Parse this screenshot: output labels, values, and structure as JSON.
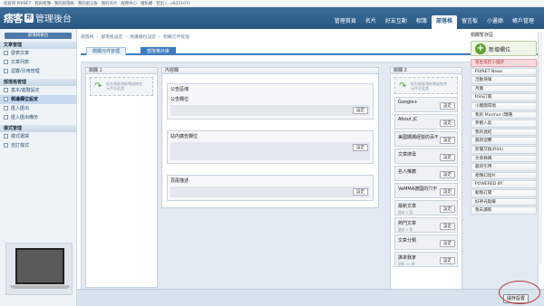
{
  "topbar": {
    "links": [
      "痞客邦 PIXNET",
      "我的相簿",
      "我的部落格",
      "我的留言板",
      "我的名片",
      "服務中心",
      "隱私權",
      "登出 (...e821107)"
    ]
  },
  "header": {
    "logo_main": "痞客",
    "logo_badge": "邦",
    "logo_sub": "管理後台",
    "nav": [
      "管理首頁",
      "名片",
      "好友互動",
      "相簿",
      "部落格",
      "留言板",
      "小畫廊",
      "帳戶管理"
    ],
    "active_nav": "部落格"
  },
  "sidebar": {
    "tag": "部落格後台",
    "sections": [
      {
        "title": "文章管理",
        "items": [
          "發表文章",
          "文章列表",
          "迴響/引用管理"
        ]
      },
      {
        "title": "部落格管理",
        "items": [
          "基本/進階設定",
          "側邊欄位設定",
          "匯入匯出",
          "匯入匯出備份"
        ]
      },
      {
        "title": "樣式管理",
        "items": [
          "樣式選擇",
          "自訂樣式"
        ]
      }
    ],
    "selected": "側邊欄位設定"
  },
  "breadcrumb": [
    "部落格",
    "›",
    "部落格設定",
    "›",
    "側邊欄位設定",
    "›",
    "側欄元件管理"
  ],
  "tabs": [
    "側欄元件管理",
    "部落格外掛"
  ],
  "active_tab": "部落格外掛",
  "columns": {
    "col1": {
      "title": "側欄 1",
      "drop_text": "從右側區塊新增或拖曳元件至此處"
    },
    "main": {
      "title": "內容欄",
      "groups": [
        {
          "title": "公告區塊",
          "module": "公告欄位",
          "btn": "設定"
        },
        {
          "title": "站內廣告欄位",
          "module": "",
          "btn": "設定"
        },
        {
          "title": "頁尾描述",
          "module": "",
          "btn": "設定"
        }
      ]
    },
    "col2": {
      "title": "側欄 2",
      "drop_text": "從右側區塊新增或拖曳元件至此處",
      "items": [
        {
          "name": "Google+",
          "sub": "",
          "btn": "設定"
        },
        {
          "name": "About JC",
          "sub": "",
          "btn": "設定"
        },
        {
          "name": "美國媽媽經營的百不",
          "sub": "",
          "btn": "設定"
        },
        {
          "name": "文章搜尋",
          "sub": "",
          "btn": "設定"
        },
        {
          "name": "名人推薦",
          "sub": "",
          "btn": "設定"
        },
        {
          "name": "VeMMA德國的穴不",
          "sub": "",
          "btn": "設定"
        },
        {
          "name": "最新文章",
          "sub": "最新 5 篇",
          "btn": "設定"
        },
        {
          "name": "熱門文章",
          "sub": "最新 5 篇",
          "btn": "設定"
        },
        {
          "name": "文章分類",
          "sub": "",
          "btn": "設定"
        },
        {
          "name": "誰來我家",
          "sub": "最新 10 筆",
          "btn": "設定"
        }
      ]
    }
  },
  "pool": {
    "title": "側欄暫存區",
    "add_label": "新增欄位",
    "items": [
      {
        "name": "等生等於小錢步",
        "hl": true
      },
      {
        "name": "PIXNET News",
        "hl": false
      },
      {
        "name": "活動快報",
        "hl": false
      },
      {
        "name": "月曆",
        "hl": false
      },
      {
        "name": "RSS訂閱",
        "hl": false
      },
      {
        "name": "小圖圖環境",
        "hl": false
      },
      {
        "name": "我的 Murmur (噗嚕",
        "hl": false
      },
      {
        "name": "參觀人氣",
        "hl": false
      },
      {
        "name": "我的連結",
        "hl": false
      },
      {
        "name": "最新迴響",
        "hl": false
      },
      {
        "name": "新聞交換(RSS)",
        "hl": false
      },
      {
        "name": "文章條碼",
        "hl": false
      },
      {
        "name": "最新引用",
        "hl": false
      },
      {
        "name": "相簿幻燈片",
        "hl": false
      },
      {
        "name": "POWERED BY",
        "hl": false
      },
      {
        "name": "動態訂閱",
        "hl": false
      },
      {
        "name": "好神光點擊",
        "hl": false
      },
      {
        "name": "我去讀家",
        "hl": false
      }
    ]
  },
  "save_label": "儲存設置"
}
